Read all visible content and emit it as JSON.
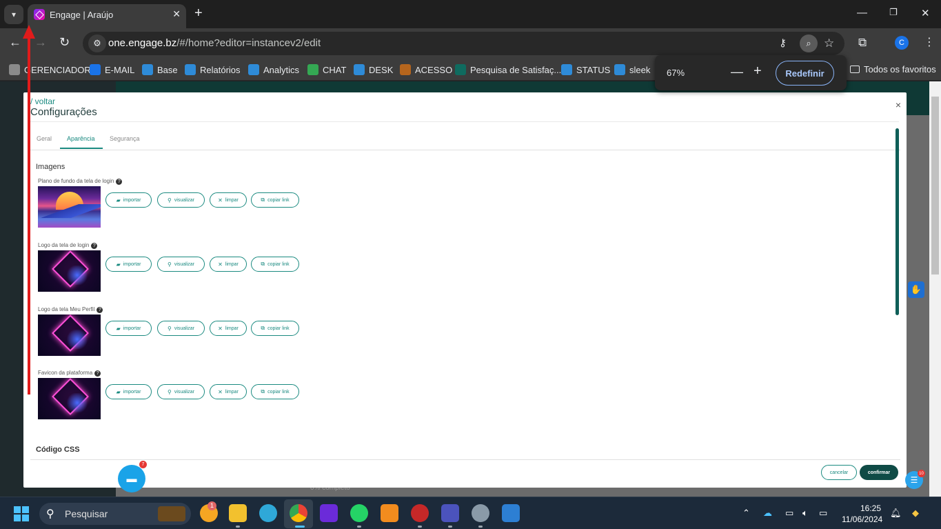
{
  "browser": {
    "tab_title": "Engage | Araújo",
    "url_host": "one.engage.bz",
    "url_path": "/#/home?editor=instancev2/edit",
    "profile_initial": "C",
    "bookmarks": [
      {
        "label": "GERENCIADOR",
        "color": "#8a8a8a"
      },
      {
        "label": "E-MAIL",
        "color": "#1a73e8"
      },
      {
        "label": "Base",
        "color": "#2e8bd8"
      },
      {
        "label": "Relatórios",
        "color": "#2e8bd8"
      },
      {
        "label": "Analytics",
        "color": "#2e8bd8"
      },
      {
        "label": "CHAT",
        "color": "#34a853"
      },
      {
        "label": "DESK",
        "color": "#2e8bd8"
      },
      {
        "label": "ACESSO",
        "color": "#b5651d"
      },
      {
        "label": "Pesquisa de Satisfaç...",
        "color": "#0f6b5f"
      },
      {
        "label": "STATUS",
        "color": "#2e8bd8"
      },
      {
        "label": "sleek",
        "color": "#2e8bd8"
      }
    ],
    "all_bookmarks_label": "Todos os favoritos",
    "zoom_popup": {
      "level": "67%",
      "minus": "—",
      "plus": "+",
      "reset_label": "Redefinir"
    }
  },
  "modal": {
    "back_link": "/ voltar",
    "title": "Configurações",
    "close": "×",
    "tabs": [
      {
        "label": "Geral",
        "active": false
      },
      {
        "label": "Aparência",
        "active": true
      },
      {
        "label": "Segurança",
        "active": false
      }
    ],
    "section_images": "Imagens",
    "image_rows": [
      {
        "label": "Plano de fundo da tela de login",
        "thumb": "sunset"
      },
      {
        "label": "Logo da tela de login",
        "thumb": "neon"
      },
      {
        "label": "Logo da tela Meu Perfil",
        "thumb": "neon"
      },
      {
        "label": "Favicon da plataforma",
        "thumb": "neon"
      }
    ],
    "help_glyph": "?",
    "actions": {
      "import": "importar",
      "view": "visualizar",
      "clear": "limpar",
      "copy": "copiar link"
    },
    "section_css": "Código CSS",
    "cancel_label": "cancelar",
    "confirm_label": "confirmar"
  },
  "page": {
    "progress_text": "0% completo",
    "chat_badge": "7",
    "help_badge": "10"
  },
  "taskbar": {
    "search_label": "Pesquisar",
    "weather_badge": "1",
    "time": "16:25",
    "date": "11/06/2024"
  },
  "colors": {
    "accent": "#1a8a80",
    "confirm_bg": "#0f4b46",
    "annotation_arrow": "#e11b1b"
  }
}
